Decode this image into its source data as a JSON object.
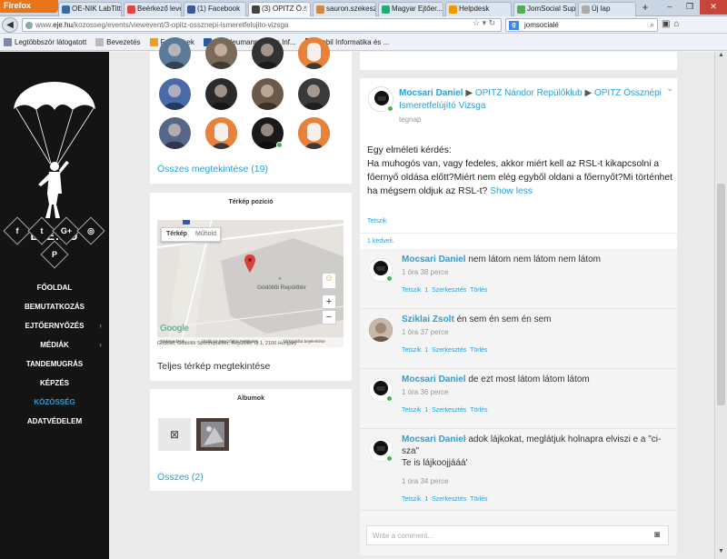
{
  "browser": {
    "firefox_label": "Firefox",
    "tabs": [
      {
        "label": "OE-NIK LabTitt",
        "color": "#3b6aa0"
      },
      {
        "label": "Beérkező level...",
        "color": "#d44"
      },
      {
        "label": "(1) Facebook",
        "color": "#3b5998"
      },
      {
        "label": "(3) OPITZ Ö...",
        "color": "#444"
      },
      {
        "label": "sauron.szekesz...",
        "color": "#c84"
      },
      {
        "label": "Magyar Ejtőer...",
        "color": "#2a7"
      },
      {
        "label": "Helpdesk",
        "color": "#e90"
      },
      {
        "label": "JomSocial Sup...",
        "color": "#5a5"
      },
      {
        "label": "Új lap",
        "color": "#aaa"
      }
    ],
    "new_tab": "+",
    "url_prefix": "www.",
    "url_domain": "eje.hu",
    "url_path": "/kozosseg/events/viewevent/3-opitz-ossznepi-ismeretfelujito-vizsga",
    "search_value": "jomsocialé",
    "bookmarks": [
      {
        "label": "Legtöbbször látogatott",
        "color": "#7a8aa0"
      },
      {
        "label": "Bevezetés",
        "color": "#bbb"
      },
      {
        "label": "Friss hírek",
        "color": "#e8a02a"
      },
      {
        "label": "ÓE Neumann János Inf...",
        "color": "#2a5aa0"
      },
      {
        "label": "Mobil Informatika és ...",
        "color": "#222"
      }
    ]
  },
  "sidebar": {
    "site_name": "EJE.HU",
    "social": [
      "f",
      "t",
      "G+",
      "◎",
      "P"
    ],
    "menu": [
      {
        "label": "FŐOLDAL",
        "arrow": false,
        "active": false
      },
      {
        "label": "BEMUTATKOZÁS",
        "arrow": false,
        "active": false
      },
      {
        "label": "EJTŐERNYŐZÉS",
        "arrow": true,
        "active": false
      },
      {
        "label": "MÉDIÁK",
        "arrow": true,
        "active": false
      },
      {
        "label": "TANDEMUGRÁS",
        "arrow": false,
        "active": false
      },
      {
        "label": "KÉPZÉS",
        "arrow": false,
        "active": false
      },
      {
        "label": "KÖZÖSSÉG",
        "arrow": false,
        "active": true
      },
      {
        "label": "ADATVÉDELEM",
        "arrow": false,
        "active": false
      }
    ]
  },
  "members": {
    "all_link": "Összes megtekintése (19)"
  },
  "map_box": {
    "title": "Térkép pozíció",
    "map_type_1": "Térkép",
    "map_type_2": "Műhold",
    "place_label": "Gödöllői Repülőtér",
    "google": "Google",
    "footer_1": "Térképadatok",
    "footer_2": "Általános Szerződési Feltételek",
    "footer_3": "Térképhiba bejelentése",
    "address": "Gödöllő, Gödöllői Sportrepülőtér, Repülőtér út 1, 2100 Hungary",
    "view_full": "Teljes térkép megtekintése",
    "zoom_in": "+",
    "zoom_out": "−"
  },
  "albums": {
    "title": "Albumok",
    "all_link": "Összes (2)"
  },
  "post": {
    "author": "Mocsari Daniel",
    "sep1": "▶",
    "target1": "OPITZ Nándor Repülőklub",
    "sep2": "▶",
    "target2": "OPITZ Össznépi Ismeretfelújító Vizsga",
    "time": "tegnap",
    "text_line1": "Egy elméleti kérdés:",
    "text_line2": "Ha muhogós van, vagy fedeles, akkor miért kell az RSL-t kikapcsolni a",
    "text_line3": "főernyő oldása előtt?Miért nem elég egyből oldani a főernyőt?Mi történhet",
    "text_line4": "ha mégsem oldjuk az RSL-t?",
    "show_less": "Show less",
    "like": "Tetszik",
    "likes_count": "1 kedveli.",
    "collapse": "⌄"
  },
  "comments": [
    {
      "author": "Mocsari Daniel",
      "text": "nem látom nem látom nem látom",
      "text2": "",
      "time": "1 óra 38 perce",
      "online": true
    },
    {
      "author": "Sziklai Zsolt",
      "text": "én sem én sem én sem",
      "text2": "",
      "time": "1 óra 37 perce",
      "online": false
    },
    {
      "author": "Mocsari Daniel",
      "text": "de ezt most látom látom látom",
      "text2": "",
      "time": "1 óra 36 perce",
      "online": true
    },
    {
      "author": "Mocsari Daniel",
      "text": "adok lájkokat, meglátjuk holnapra elviszi e a \"ci-",
      "text_cont": "sza\"",
      "text2": "Te is lájkoojjááá'",
      "time": "1 óra 34 perce",
      "online": true
    }
  ],
  "comment_actions": {
    "like": "Tetszik",
    "count": "1",
    "edit": "Szerkesztés",
    "delete": "Törlés"
  },
  "comment_input": {
    "placeholder": "Write a comment..."
  }
}
